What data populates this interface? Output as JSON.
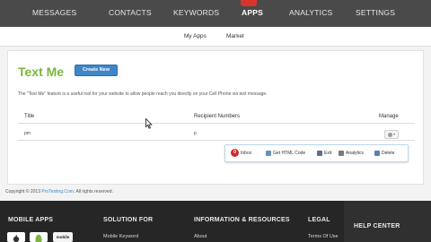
{
  "nav": {
    "items": [
      "MESSAGES",
      "CONTACTS",
      "KEYWORDS",
      "APPS",
      "ANALYTICS",
      "SETTINGS"
    ],
    "active": "APPS"
  },
  "subnav": {
    "my_apps": "My Apps",
    "market": "Market"
  },
  "page": {
    "title": "Text Me",
    "create_button": "Create New",
    "description": "The \"Text Me\" feature is a useful tool for your website to allow people reach you directly on your Cell Phone via text message."
  },
  "table": {
    "headers": {
      "title": "Title",
      "recipients": "Recipient Numbers",
      "manage": "Manage"
    },
    "rows": [
      {
        "title": "pm",
        "recipients": "p"
      }
    ]
  },
  "actions": {
    "inbox_count": "0",
    "inbox": "Inbox",
    "get_html": "Get HTML Code",
    "exit": "Exit",
    "analytics": "Analytics",
    "delete": "Delete"
  },
  "copyright": {
    "text": "Copyright © 2013",
    "link": "ProTexting.Com",
    "rights": ". All rights reserved."
  },
  "footer": {
    "headings": {
      "mobile_apps": "MOBILE APPS",
      "solution_for": "SOLUTION FOR",
      "info": "INFORMATION & RESOURCES",
      "legal": "LEGAL",
      "help": "HELP CENTER"
    },
    "links": {
      "solution": "Mobile Keyword",
      "info": "About",
      "legal": "Terms Of Use"
    },
    "store_badge_label": "mobile"
  },
  "colors": {
    "nav_bg": "#4a4a4a",
    "title_green": "#7cb342",
    "button_blue": "#3f86c9",
    "footer_bg": "#262626",
    "badge_red": "#d9342a"
  }
}
